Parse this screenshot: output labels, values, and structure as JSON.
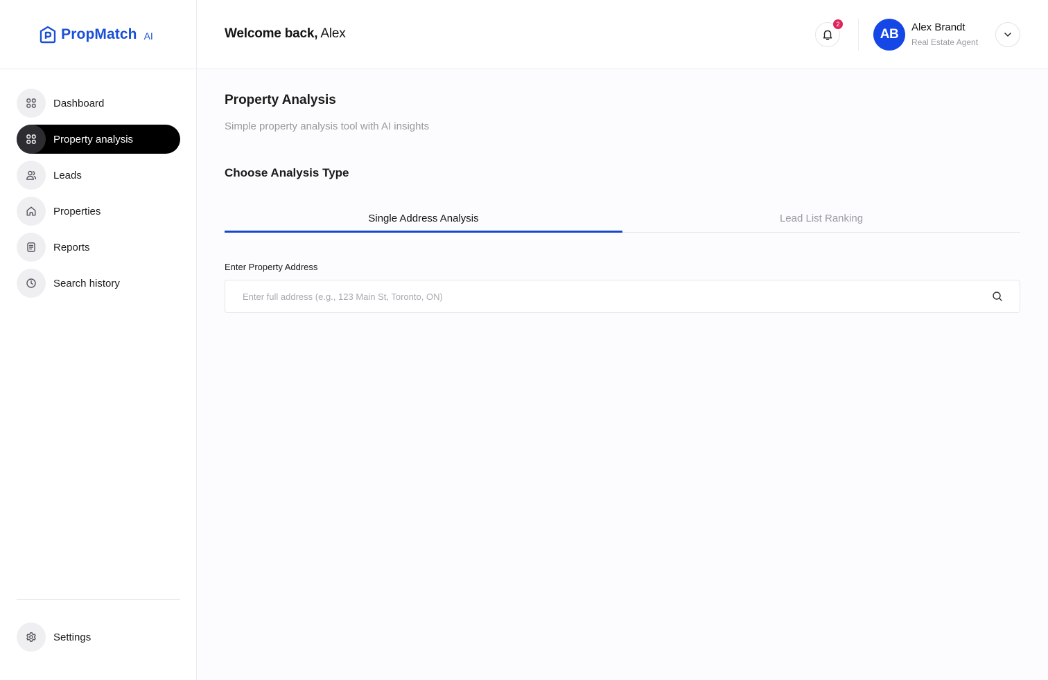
{
  "brand": {
    "name": "PropMatch",
    "suffix": "AI",
    "color": "#1a4fd6"
  },
  "sidebar": {
    "items": [
      {
        "label": "Dashboard",
        "icon": "grid-icon",
        "active": false
      },
      {
        "label": "Property analysis",
        "icon": "grid-icon",
        "active": true
      },
      {
        "label": "Leads",
        "icon": "users-icon",
        "active": false
      },
      {
        "label": "Properties",
        "icon": "home-icon",
        "active": false
      },
      {
        "label": "Reports",
        "icon": "document-icon",
        "active": false
      },
      {
        "label": "Search history",
        "icon": "clock-icon",
        "active": false
      }
    ],
    "bottom": {
      "label": "Settings",
      "icon": "gear-icon"
    }
  },
  "header": {
    "welcome_prefix": "Welcome back,",
    "welcome_name": "Alex",
    "notifications_count": "2",
    "user": {
      "initials": "AB",
      "name": "Alex Brandt",
      "role": "Real Estate Agent"
    }
  },
  "main": {
    "title": "Property Analysis",
    "subtitle": "Simple property analysis tool with AI insights",
    "section_title": "Choose Analysis Type",
    "tabs": [
      {
        "label": "Single Address Analysis",
        "active": true
      },
      {
        "label": "Lead List Ranking",
        "active": false
      }
    ],
    "address_label": "Enter Property Address",
    "address_placeholder": "Enter full address (e.g., 123 Main St, Toronto, ON)",
    "address_value": ""
  },
  "colors": {
    "accent": "#1547c9",
    "avatar": "#1547e6",
    "badge": "#e0245e"
  }
}
